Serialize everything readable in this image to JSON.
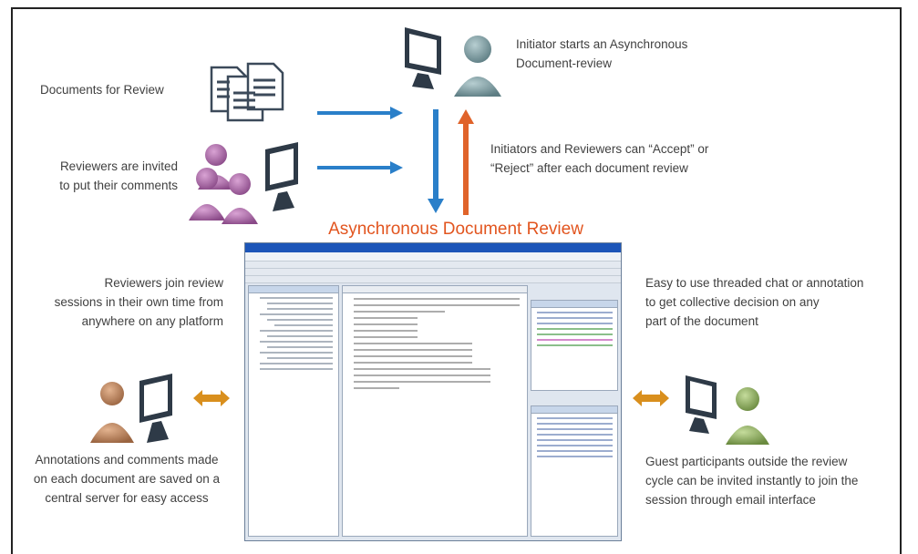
{
  "labels": {
    "documents": "Documents for Review",
    "reviewers_1": "Reviewers are invited",
    "reviewers_2": "to put their comments",
    "initiator_1": "Initiator starts an Asynchronous",
    "initiator_2": "Document-review",
    "accept_1": "Initiators and Reviewers can “Accept” or",
    "accept_2": "“Reject” after each document review",
    "title": "Asynchronous Document Review",
    "join_1": "Reviewers  join review",
    "join_2": "sessions in their own time from",
    "join_3": "anywhere on any platform",
    "chat_1": "Easy to use threaded chat or annotation",
    "chat_2": "to get collective decision on any",
    "chat_3": "part of the document",
    "annot_1": "Annotations and comments made",
    "annot_2": "on each document are saved on a",
    "annot_3": "central server for easy access",
    "guest_1": "Guest participants outside the review",
    "guest_2": "cycle can be invited instantly to join the",
    "guest_3": "session through email interface"
  },
  "colors": {
    "blue_arrow": "#2a7fc9",
    "orange_arrow": "#e0632a",
    "gold_arrow": "#d98f1d",
    "title": "#e2551f",
    "person_purple": "#9d5a9a",
    "person_teal": "#6f8f94",
    "person_brown": "#b07a55",
    "person_green": "#86a45a"
  }
}
